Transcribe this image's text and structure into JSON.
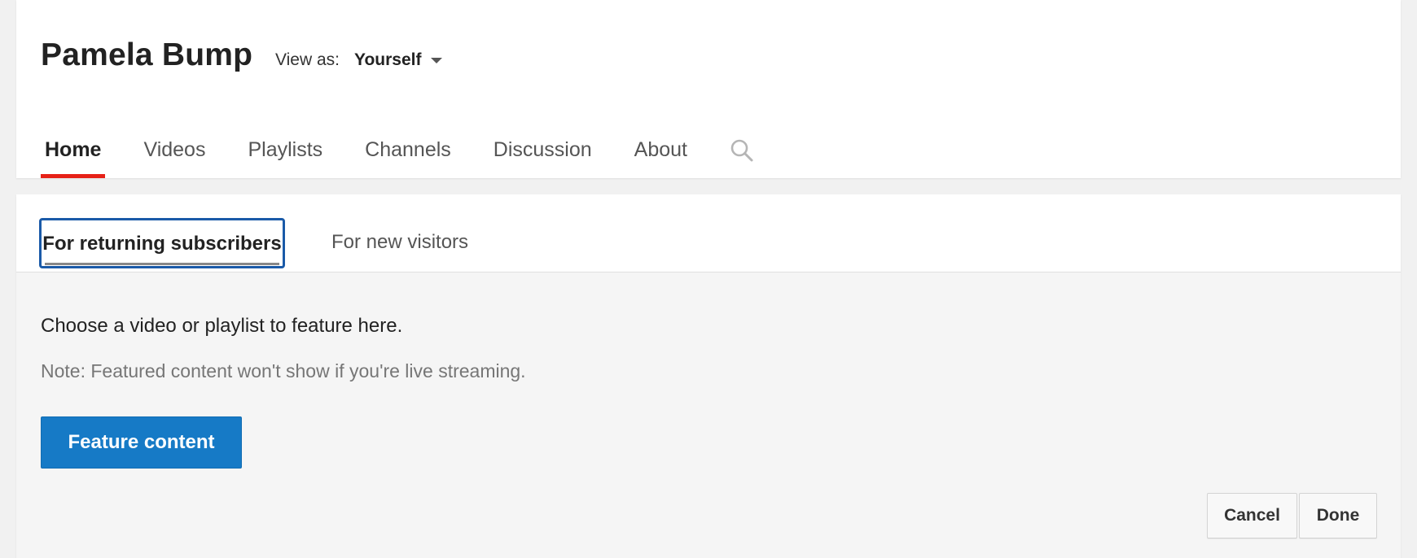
{
  "header": {
    "channel_name": "Pamela Bump",
    "view_as": {
      "label": "View as:",
      "value": "Yourself"
    },
    "nav": {
      "items": [
        {
          "label": "Home",
          "active": true
        },
        {
          "label": "Videos",
          "active": false
        },
        {
          "label": "Playlists",
          "active": false
        },
        {
          "label": "Channels",
          "active": false
        },
        {
          "label": "Discussion",
          "active": false
        },
        {
          "label": "About",
          "active": false
        }
      ],
      "search_icon": "search-icon"
    }
  },
  "featured": {
    "tabs": [
      {
        "label": "For returning subscribers",
        "active": true
      },
      {
        "label": "For new visitors",
        "active": false
      }
    ],
    "prompt": "Choose a video or playlist to feature here.",
    "note": "Note: Featured content won't show if you're live streaming.",
    "feature_button": "Feature content",
    "cancel_button": "Cancel",
    "done_button": "Done"
  },
  "colors": {
    "accent_blue": "#167ac6",
    "active_tab_underline": "#e62117",
    "focus_border": "#1a5aa8"
  }
}
